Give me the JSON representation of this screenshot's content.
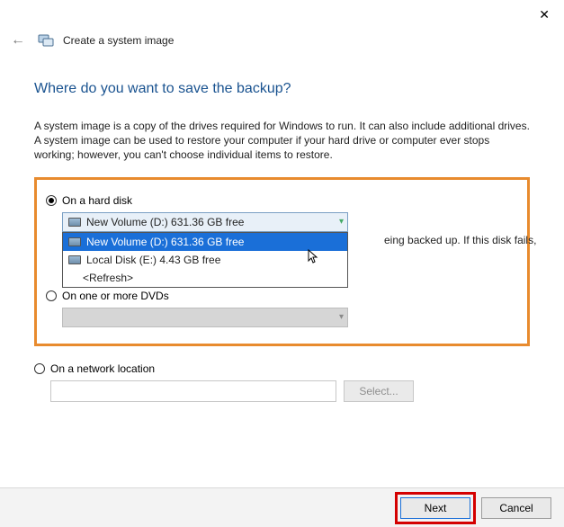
{
  "window": {
    "title": "Create a system image"
  },
  "page": {
    "heading": "Where do you want to save the backup?",
    "description": "A system image is a copy of the drives required for Windows to run. It can also include additional drives. A system image can be used to restore your computer if your hard drive or computer ever stops working; however, you can't choose individual items to restore."
  },
  "options": {
    "harddisk": {
      "label": "On a hard disk",
      "selected_value": "New Volume (D:)  631.36 GB free",
      "items": [
        {
          "label": "New Volume (D:)  631.36 GB free",
          "highlighted": true
        },
        {
          "label": "Local Disk (E:)  4.43 GB free",
          "highlighted": false
        }
      ],
      "refresh": "<Refresh>",
      "side_note": "eing backed up. If this disk fails,"
    },
    "dvd": {
      "label": "On one or more DVDs"
    },
    "network": {
      "label": "On a network location",
      "select_button": "Select..."
    }
  },
  "footer": {
    "next": "Next",
    "cancel": "Cancel"
  }
}
